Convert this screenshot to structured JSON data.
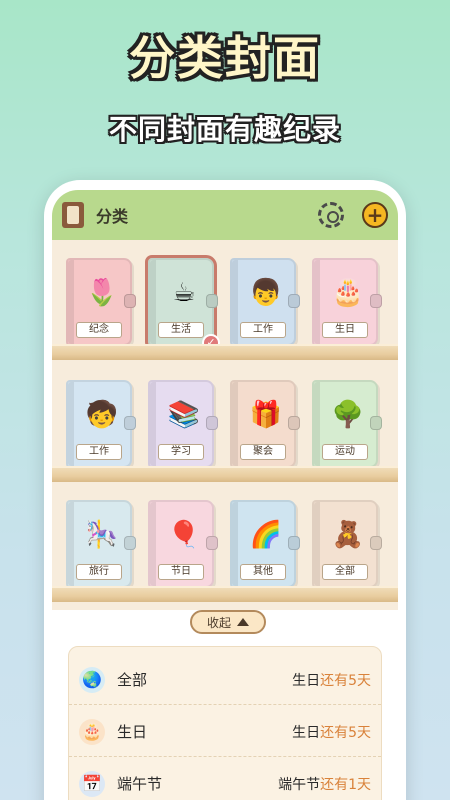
{
  "hero": {
    "title": "分类封面",
    "subtitle": "不同封面有趣纪录"
  },
  "header": {
    "title": "分类"
  },
  "shelves": [
    [
      {
        "label": "纪念",
        "color": "#f6c7c7",
        "icon": "girl-tulip-icon",
        "glyph": "🌷"
      },
      {
        "label": "生活",
        "color": "#cfe3d7",
        "icon": "coffee-icon",
        "glyph": "☕",
        "selected": true
      },
      {
        "label": "工作",
        "color": "#cfe0ef",
        "icon": "boy-icon",
        "glyph": "👦"
      },
      {
        "label": "生日",
        "color": "#f8d2da",
        "icon": "cake-icon",
        "glyph": "🎂"
      }
    ],
    [
      {
        "label": "工作",
        "color": "#d4e5f2",
        "icon": "student-icon",
        "glyph": "🧒"
      },
      {
        "label": "学习",
        "color": "#e6dcf0",
        "icon": "studying-icon",
        "glyph": "📚"
      },
      {
        "label": "聚会",
        "color": "#f4dccd",
        "icon": "party-icon",
        "glyph": "🎁"
      },
      {
        "label": "运动",
        "color": "#d6ecd0",
        "icon": "bear-icon",
        "glyph": "🌳"
      }
    ],
    [
      {
        "label": "旅行",
        "color": "#d8e9ee",
        "icon": "carousel-icon",
        "glyph": "🎠"
      },
      {
        "label": "节日",
        "color": "#f8d7df",
        "icon": "balloon-icon",
        "glyph": "🎈"
      },
      {
        "label": "其他",
        "color": "#cfe4f0",
        "icon": "rainbow-icon",
        "glyph": "🌈"
      },
      {
        "label": "全部",
        "color": "#f3e1d1",
        "icon": "teddy-icon",
        "glyph": "🧸"
      }
    ]
  ],
  "collapse_label": "收起",
  "list": [
    {
      "name": "全部",
      "count_prefix": "生日",
      "count_hl": "还有5天",
      "icon": "globe-icon",
      "glyph": "🌏",
      "bg": "#d6ecf5"
    },
    {
      "name": "生日",
      "count_prefix": "生日",
      "count_hl": "还有5天",
      "icon": "cake-icon",
      "glyph": "🎂",
      "bg": "#fbe3c8"
    },
    {
      "name": "端午节",
      "count_prefix": "端午节",
      "count_hl": "还有1天",
      "icon": "calendar-icon",
      "glyph": "📅",
      "bg": "#dce8f5"
    }
  ]
}
